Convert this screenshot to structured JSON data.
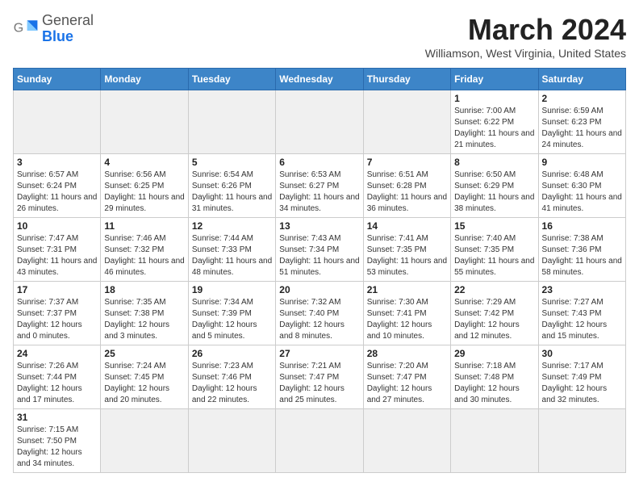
{
  "header": {
    "logo_line1": "General",
    "logo_line2": "Blue",
    "month_title": "March 2024",
    "location": "Williamson, West Virginia, United States"
  },
  "weekdays": [
    "Sunday",
    "Monday",
    "Tuesday",
    "Wednesday",
    "Thursday",
    "Friday",
    "Saturday"
  ],
  "weeks": [
    [
      {
        "day": "",
        "info": ""
      },
      {
        "day": "",
        "info": ""
      },
      {
        "day": "",
        "info": ""
      },
      {
        "day": "",
        "info": ""
      },
      {
        "day": "",
        "info": ""
      },
      {
        "day": "1",
        "info": "Sunrise: 7:00 AM\nSunset: 6:22 PM\nDaylight: 11 hours and 21 minutes."
      },
      {
        "day": "2",
        "info": "Sunrise: 6:59 AM\nSunset: 6:23 PM\nDaylight: 11 hours and 24 minutes."
      }
    ],
    [
      {
        "day": "3",
        "info": "Sunrise: 6:57 AM\nSunset: 6:24 PM\nDaylight: 11 hours and 26 minutes."
      },
      {
        "day": "4",
        "info": "Sunrise: 6:56 AM\nSunset: 6:25 PM\nDaylight: 11 hours and 29 minutes."
      },
      {
        "day": "5",
        "info": "Sunrise: 6:54 AM\nSunset: 6:26 PM\nDaylight: 11 hours and 31 minutes."
      },
      {
        "day": "6",
        "info": "Sunrise: 6:53 AM\nSunset: 6:27 PM\nDaylight: 11 hours and 34 minutes."
      },
      {
        "day": "7",
        "info": "Sunrise: 6:51 AM\nSunset: 6:28 PM\nDaylight: 11 hours and 36 minutes."
      },
      {
        "day": "8",
        "info": "Sunrise: 6:50 AM\nSunset: 6:29 PM\nDaylight: 11 hours and 38 minutes."
      },
      {
        "day": "9",
        "info": "Sunrise: 6:48 AM\nSunset: 6:30 PM\nDaylight: 11 hours and 41 minutes."
      }
    ],
    [
      {
        "day": "10",
        "info": "Sunrise: 7:47 AM\nSunset: 7:31 PM\nDaylight: 11 hours and 43 minutes."
      },
      {
        "day": "11",
        "info": "Sunrise: 7:46 AM\nSunset: 7:32 PM\nDaylight: 11 hours and 46 minutes."
      },
      {
        "day": "12",
        "info": "Sunrise: 7:44 AM\nSunset: 7:33 PM\nDaylight: 11 hours and 48 minutes."
      },
      {
        "day": "13",
        "info": "Sunrise: 7:43 AM\nSunset: 7:34 PM\nDaylight: 11 hours and 51 minutes."
      },
      {
        "day": "14",
        "info": "Sunrise: 7:41 AM\nSunset: 7:35 PM\nDaylight: 11 hours and 53 minutes."
      },
      {
        "day": "15",
        "info": "Sunrise: 7:40 AM\nSunset: 7:35 PM\nDaylight: 11 hours and 55 minutes."
      },
      {
        "day": "16",
        "info": "Sunrise: 7:38 AM\nSunset: 7:36 PM\nDaylight: 11 hours and 58 minutes."
      }
    ],
    [
      {
        "day": "17",
        "info": "Sunrise: 7:37 AM\nSunset: 7:37 PM\nDaylight: 12 hours and 0 minutes."
      },
      {
        "day": "18",
        "info": "Sunrise: 7:35 AM\nSunset: 7:38 PM\nDaylight: 12 hours and 3 minutes."
      },
      {
        "day": "19",
        "info": "Sunrise: 7:34 AM\nSunset: 7:39 PM\nDaylight: 12 hours and 5 minutes."
      },
      {
        "day": "20",
        "info": "Sunrise: 7:32 AM\nSunset: 7:40 PM\nDaylight: 12 hours and 8 minutes."
      },
      {
        "day": "21",
        "info": "Sunrise: 7:30 AM\nSunset: 7:41 PM\nDaylight: 12 hours and 10 minutes."
      },
      {
        "day": "22",
        "info": "Sunrise: 7:29 AM\nSunset: 7:42 PM\nDaylight: 12 hours and 12 minutes."
      },
      {
        "day": "23",
        "info": "Sunrise: 7:27 AM\nSunset: 7:43 PM\nDaylight: 12 hours and 15 minutes."
      }
    ],
    [
      {
        "day": "24",
        "info": "Sunrise: 7:26 AM\nSunset: 7:44 PM\nDaylight: 12 hours and 17 minutes."
      },
      {
        "day": "25",
        "info": "Sunrise: 7:24 AM\nSunset: 7:45 PM\nDaylight: 12 hours and 20 minutes."
      },
      {
        "day": "26",
        "info": "Sunrise: 7:23 AM\nSunset: 7:46 PM\nDaylight: 12 hours and 22 minutes."
      },
      {
        "day": "27",
        "info": "Sunrise: 7:21 AM\nSunset: 7:47 PM\nDaylight: 12 hours and 25 minutes."
      },
      {
        "day": "28",
        "info": "Sunrise: 7:20 AM\nSunset: 7:47 PM\nDaylight: 12 hours and 27 minutes."
      },
      {
        "day": "29",
        "info": "Sunrise: 7:18 AM\nSunset: 7:48 PM\nDaylight: 12 hours and 30 minutes."
      },
      {
        "day": "30",
        "info": "Sunrise: 7:17 AM\nSunset: 7:49 PM\nDaylight: 12 hours and 32 minutes."
      }
    ],
    [
      {
        "day": "31",
        "info": "Sunrise: 7:15 AM\nSunset: 7:50 PM\nDaylight: 12 hours and 34 minutes."
      },
      {
        "day": "",
        "info": ""
      },
      {
        "day": "",
        "info": ""
      },
      {
        "day": "",
        "info": ""
      },
      {
        "day": "",
        "info": ""
      },
      {
        "day": "",
        "info": ""
      },
      {
        "day": "",
        "info": ""
      }
    ]
  ]
}
